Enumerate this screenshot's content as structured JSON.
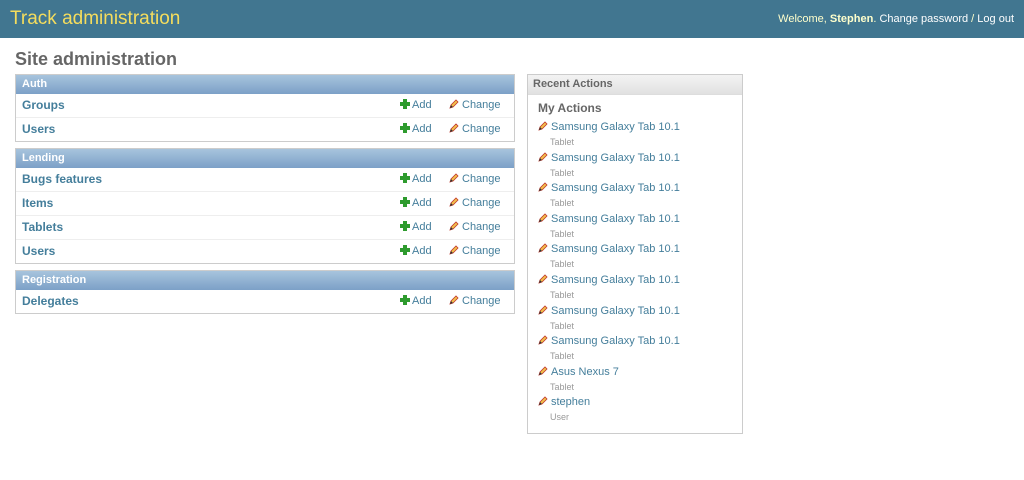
{
  "header": {
    "title": "Track administration",
    "welcome_prefix": "Welcome, ",
    "username": "Stephen",
    "welcome_suffix": ".",
    "change_password": "Change password",
    "separator": "/",
    "logout": "Log out"
  },
  "page_title": "Site administration",
  "common": {
    "add_label": "Add",
    "change_label": "Change"
  },
  "modules": [
    {
      "caption": "Auth",
      "models": [
        "Groups",
        "Users"
      ]
    },
    {
      "caption": "Lending",
      "models": [
        "Bugs features",
        "Items",
        "Tablets",
        "Users"
      ]
    },
    {
      "caption": "Registration",
      "models": [
        "Delegates"
      ]
    }
  ],
  "recent_actions": {
    "caption": "Recent Actions",
    "my_actions_title": "My Actions",
    "items": [
      {
        "label": "Samsung Galaxy Tab 10.1",
        "type": "Tablet",
        "icon": "pencil-icon"
      },
      {
        "label": "Samsung Galaxy Tab 10.1",
        "type": "Tablet",
        "icon": "pencil-icon"
      },
      {
        "label": "Samsung Galaxy Tab 10.1",
        "type": "Tablet",
        "icon": "pencil-icon"
      },
      {
        "label": "Samsung Galaxy Tab 10.1",
        "type": "Tablet",
        "icon": "pencil-icon"
      },
      {
        "label": "Samsung Galaxy Tab 10.1",
        "type": "Tablet",
        "icon": "pencil-icon"
      },
      {
        "label": "Samsung Galaxy Tab 10.1",
        "type": "Tablet",
        "icon": "pencil-icon"
      },
      {
        "label": "Samsung Galaxy Tab 10.1",
        "type": "Tablet",
        "icon": "pencil-icon"
      },
      {
        "label": "Samsung Galaxy Tab 10.1",
        "type": "Tablet",
        "icon": "pencil-icon"
      },
      {
        "label": "Asus Nexus 7",
        "type": "Tablet",
        "icon": "pencil-icon"
      },
      {
        "label": "stephen",
        "type": "User",
        "icon": "pencil-icon"
      }
    ]
  },
  "colors": {
    "header_bg": "#417690",
    "title_yellow": "#f5dd5d",
    "link": "#447e9b",
    "caption_blue": "#7ca0c7"
  }
}
